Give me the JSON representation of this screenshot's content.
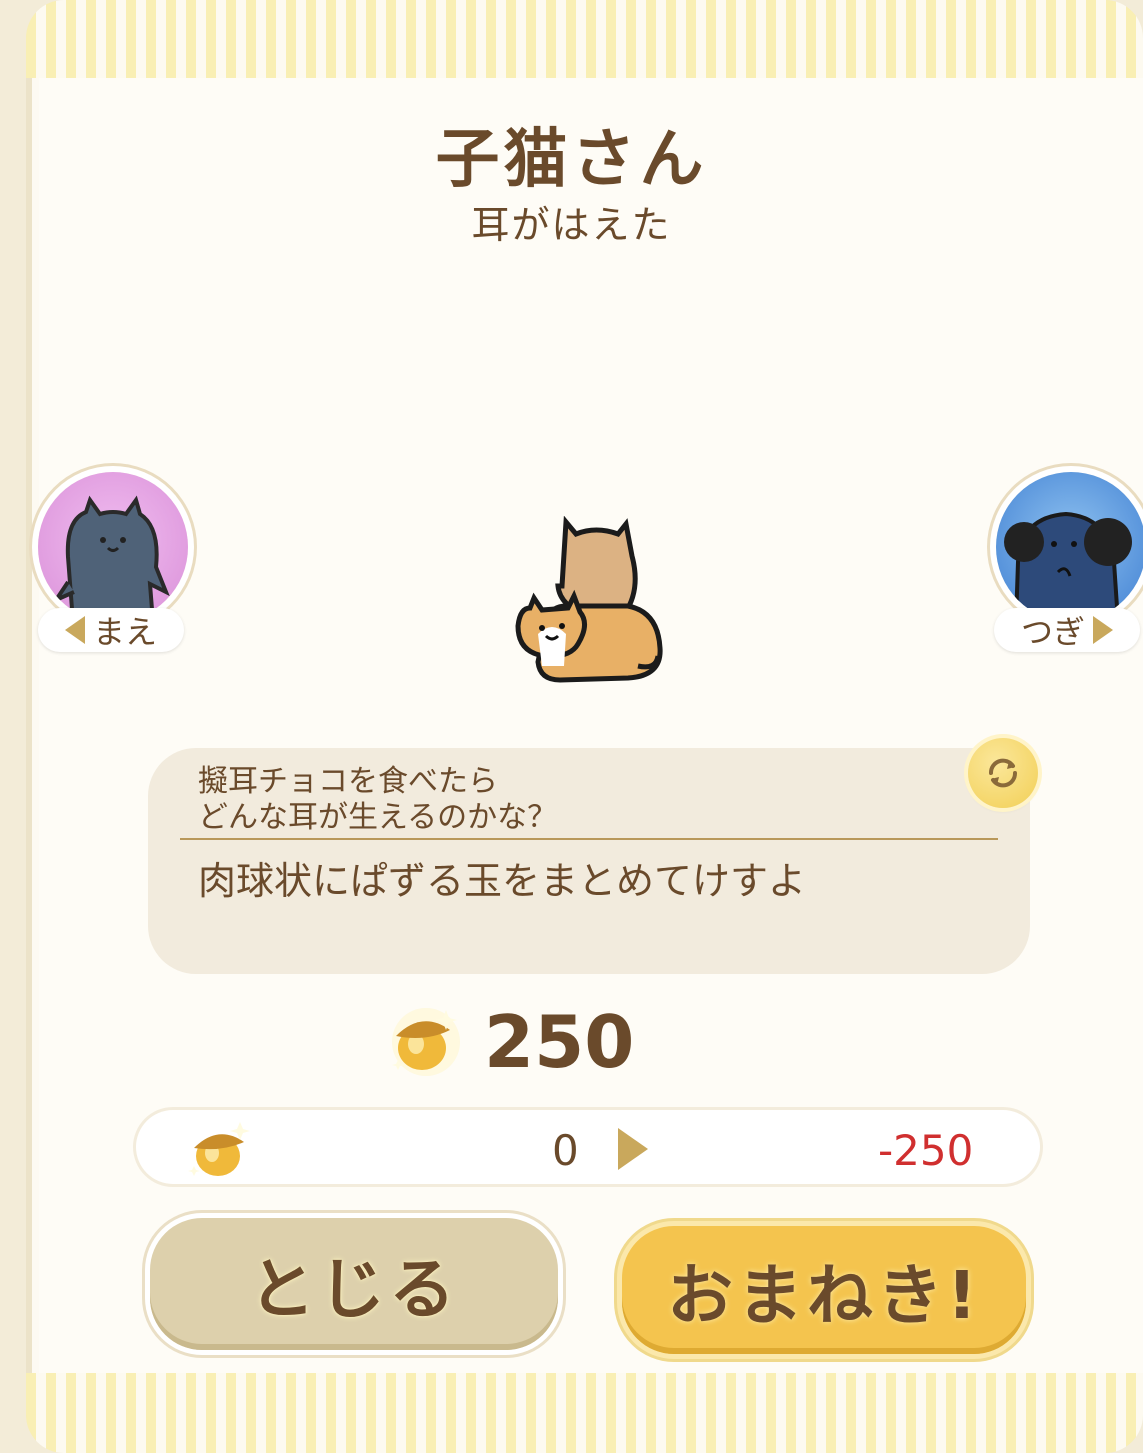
{
  "title": "子猫さん",
  "subtitle": "耳がはえた",
  "nav": {
    "prev_label": "まえ",
    "next_label": "つぎ"
  },
  "description": {
    "question_line1": "擬耳チョコを食べたら",
    "question_line2": "どんな耳が生えるのかな？",
    "answer": "肉球状にぱずる玉をまとめてけすよ"
  },
  "cost": {
    "price": "250",
    "current": "0",
    "result": "-250"
  },
  "buttons": {
    "close_label": "とじる",
    "invite_label": "おまねき!"
  },
  "colors": {
    "text_brown": "#6a4a2b",
    "accent_gold": "#f4c44e",
    "negative_red": "#d02f2f",
    "stripe_yellow": "#f9efb4"
  },
  "icons": [
    "acorn-icon",
    "refresh-icon",
    "prev-arrow-icon",
    "next-arrow-icon"
  ]
}
